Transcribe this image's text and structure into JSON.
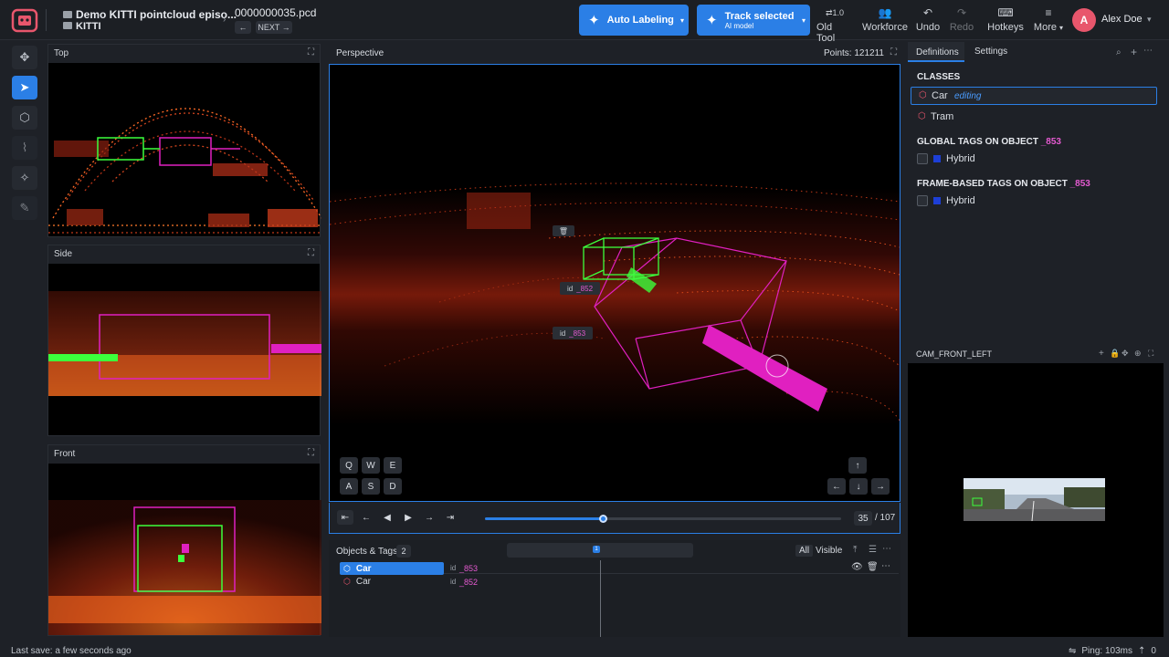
{
  "header": {
    "dataset_title": "Demo KITTI pointcloud episo...",
    "dataset_sub": "KITTI",
    "file_name": "0000000035.pcd",
    "prev_label": "←",
    "next_label": "NEXT →",
    "auto_label": "Auto Labeling",
    "track_label": "Track selected",
    "track_sub": "AI model",
    "old_tool_version": "1.0",
    "old_tool": "Old Tool",
    "workforce": "Workforce",
    "undo": "Undo",
    "redo": "Redo",
    "hotkeys": "Hotkeys",
    "more": "More",
    "avatar_initial": "A",
    "user_name": "Alex Doe"
  },
  "panels": {
    "top": "Top",
    "side": "Side",
    "front": "Front",
    "perspective": "Perspective",
    "points": "Points: 121211",
    "cam": "CAM_FRONT_LEFT"
  },
  "keys": [
    "Q",
    "W",
    "E",
    "A",
    "S",
    "D"
  ],
  "arrows": [
    "↑",
    "←",
    "↓",
    "→"
  ],
  "overlay_labels": {
    "a": "id",
    "a_val": "_852",
    "b": "id",
    "b_val": "_853"
  },
  "player": {
    "frame": "35",
    "total": "/ 107",
    "progress": 0.33
  },
  "objects": {
    "title": "Objects & Tags",
    "count": "2",
    "all": "All",
    "visible": "Visible",
    "marker": "1",
    "items": [
      {
        "class": "Car",
        "id_label": "id",
        "id": "_853",
        "color": "#e45ad0"
      },
      {
        "class": "Car",
        "id_label": "id",
        "id": "_852",
        "color": "#e45ad0"
      }
    ]
  },
  "right": {
    "tab_definitions": "Definitions",
    "tab_settings": "Settings",
    "classes_title": "CLASSES",
    "class1": "Car",
    "class1_state": "editing",
    "class2": "Tram",
    "global_tags": "GLOBAL TAGS ON OBJECT",
    "global_obj": "_853",
    "tag1": "Hybrid",
    "frame_tags": "FRAME-BASED TAGS ON OBJECT",
    "frame_obj": "_853",
    "tag2": "Hybrid"
  },
  "status": {
    "last_save": "Last save: a few seconds ago",
    "ping": "Ping: 103ms",
    "uploads": "0"
  },
  "colors": {
    "accent": "#2b7fe6",
    "magenta": "#e020c0",
    "green": "#3cff3c"
  }
}
